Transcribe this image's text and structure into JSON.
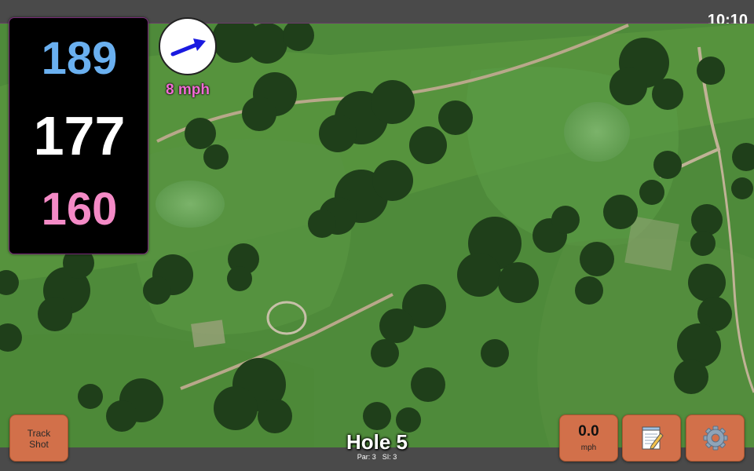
{
  "status": {
    "clock": "10:10"
  },
  "distances": {
    "back": "189",
    "center": "177",
    "front": "160"
  },
  "wind": {
    "speed_label": "8 mph",
    "icon": "wind-arrow-icon"
  },
  "buttons": {
    "track_shot_label": "Track\nShot",
    "speed_value": "0.0",
    "speed_unit": "mph",
    "notes_icon": "notepad-icon",
    "settings_icon": "gear-icon"
  },
  "hole": {
    "title": "Hole 5",
    "par": "Par: 3",
    "si": "SI: 3"
  },
  "colors": {
    "back_distance": "#6ab0f0",
    "center_distance": "#ffffff",
    "front_distance": "#f48ac6",
    "wind_text": "#f06cd4",
    "button_bg": "#d2704a",
    "fairway": "#4e8a3a",
    "tree": "#1f3f1a"
  }
}
